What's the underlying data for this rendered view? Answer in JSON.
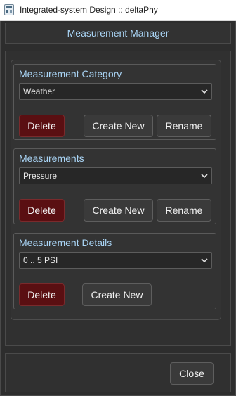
{
  "window": {
    "title": "Integrated-system Design :: deltaPhy",
    "icon": "app-logo-icon"
  },
  "header": {
    "title": "Measurement Manager"
  },
  "groups": {
    "category": {
      "title": "Measurement Category",
      "selected": "Weather",
      "delete_label": "Delete",
      "create_label": "Create New",
      "rename_label": "Rename"
    },
    "measurements": {
      "title": "Measurements",
      "selected": "Pressure",
      "delete_label": "Delete",
      "create_label": "Create New",
      "rename_label": "Rename"
    },
    "details": {
      "title": "Measurement Details",
      "selected": "0 .. 5 PSI",
      "delete_label": "Delete",
      "create_label": "Create New"
    }
  },
  "footer": {
    "close_label": "Close"
  },
  "colors": {
    "accent_text": "#a9d4f5",
    "delete_bg": "#5a0f12",
    "background": "#2d2d2d"
  },
  "icons": {
    "dropdown": "chevron-down-icon"
  }
}
